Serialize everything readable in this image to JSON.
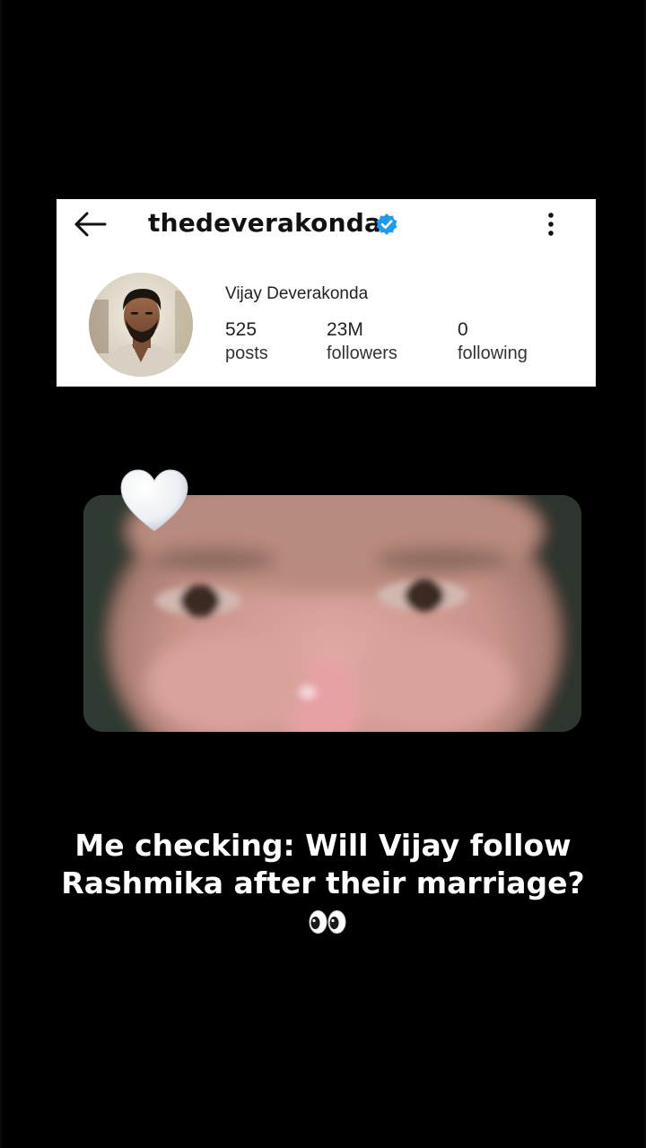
{
  "profile": {
    "username": "thedeverakonda",
    "display_name": "Vijay Deverakonda",
    "verified": true,
    "stats": [
      {
        "value": "525",
        "label": "posts"
      },
      {
        "value": "23M",
        "label": "followers"
      },
      {
        "value": "0",
        "label": "following"
      }
    ],
    "icons": {
      "back": "arrow-left-icon",
      "verified": "verified-badge-icon",
      "more": "more-vertical-icon"
    },
    "colors": {
      "verified": "#1d9bf0",
      "card_background": "#ffffff"
    }
  },
  "overlay": {
    "caption": "Me checking: Will Vijay follow Rashmika after their marriage?",
    "emoji": "👀",
    "sticker": "white-heart-icon"
  },
  "colors": {
    "background": "#000000",
    "caption_text": "#ffffff"
  }
}
